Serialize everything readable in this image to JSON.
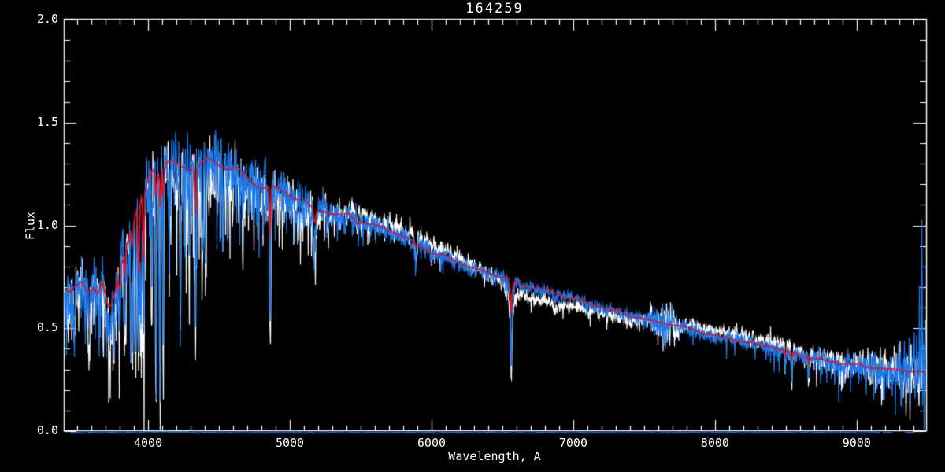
{
  "chart_data": {
    "type": "line",
    "title": "164259",
    "xlabel": "Wavelength, A",
    "ylabel": "Flux",
    "xlim": [
      3405,
      9490
    ],
    "ylim": [
      0.0,
      2.0
    ],
    "grid": false,
    "axes_box": true,
    "x_ticks": {
      "major": [
        4000,
        5000,
        6000,
        7000,
        8000,
        9000
      ],
      "labels": [
        "4000",
        "5000",
        "6000",
        "7000",
        "8000",
        "9000"
      ],
      "minor_step": 100
    },
    "y_ticks": {
      "major": [
        0.0,
        0.5,
        1.0,
        1.5,
        2.0
      ],
      "labels": [
        "0.0",
        "0.5",
        "1.0",
        "1.5",
        "2.0"
      ],
      "minor_step": 0.1
    },
    "colors": {
      "background": "#000000",
      "axis": "#ffffff",
      "observed_blue": "#1b79ea",
      "observed_white": "#ffffff",
      "model_red": "#e31227"
    },
    "series_names": [
      "observed-spectrum-white",
      "observed-spectrum-blue",
      "model-spectrum-red",
      "zero-level-spectrum"
    ],
    "model_points": [
      [
        3405,
        0.67
      ],
      [
        3450,
        0.655
      ],
      [
        3490,
        0.7
      ],
      [
        3530,
        0.735
      ],
      [
        3560,
        0.705
      ],
      [
        3590,
        0.69
      ],
      [
        3615,
        0.71
      ],
      [
        3645,
        0.665
      ],
      [
        3675,
        0.73
      ],
      [
        3700,
        0.66
      ],
      [
        3720,
        0.6
      ],
      [
        3745,
        0.625
      ],
      [
        3770,
        0.7
      ],
      [
        3800,
        0.8
      ],
      [
        3830,
        0.86
      ],
      [
        3860,
        0.93
      ],
      [
        3890,
        0.97
      ],
      [
        3920,
        1.06
      ],
      [
        3955,
        1.12
      ],
      [
        3985,
        1.18
      ],
      [
        4010,
        1.24
      ],
      [
        4040,
        1.28
      ],
      [
        4070,
        1.25
      ],
      [
        4100,
        1.28
      ],
      [
        4140,
        1.305
      ],
      [
        4180,
        1.31
      ],
      [
        4220,
        1.3
      ],
      [
        4260,
        1.3
      ],
      [
        4300,
        1.29
      ],
      [
        4340,
        1.28
      ],
      [
        4380,
        1.3
      ],
      [
        4420,
        1.31
      ],
      [
        4460,
        1.3
      ],
      [
        4500,
        1.29
      ],
      [
        4540,
        1.28
      ],
      [
        4580,
        1.265
      ],
      [
        4620,
        1.27
      ],
      [
        4660,
        1.25
      ],
      [
        4700,
        1.23
      ],
      [
        4740,
        1.22
      ],
      [
        4800,
        1.2
      ],
      [
        4861,
        1.19
      ],
      [
        4920,
        1.175
      ],
      [
        4980,
        1.16
      ],
      [
        5040,
        1.13
      ],
      [
        5100,
        1.1
      ],
      [
        5175,
        1.06
      ],
      [
        5240,
        1.08
      ],
      [
        5300,
        1.065
      ],
      [
        5360,
        1.05
      ],
      [
        5420,
        1.06
      ],
      [
        5480,
        1.025
      ],
      [
        5540,
        1.01
      ],
      [
        5620,
        0.99
      ],
      [
        5700,
        0.975
      ],
      [
        5800,
        0.945
      ],
      [
        5890,
        0.915
      ],
      [
        6000,
        0.875
      ],
      [
        6100,
        0.845
      ],
      [
        6200,
        0.815
      ],
      [
        6300,
        0.785
      ],
      [
        6400,
        0.77
      ],
      [
        6500,
        0.755
      ],
      [
        6563,
        0.745
      ],
      [
        6650,
        0.705
      ],
      [
        6750,
        0.695
      ],
      [
        6844,
        0.67
      ],
      [
        6950,
        0.655
      ],
      [
        7050,
        0.64
      ],
      [
        7122,
        0.615
      ],
      [
        7250,
        0.595
      ],
      [
        7400,
        0.558
      ],
      [
        7530,
        0.54
      ],
      [
        7650,
        0.525
      ],
      [
        7800,
        0.505
      ],
      [
        7956,
        0.468
      ],
      [
        8100,
        0.45
      ],
      [
        8250,
        0.432
      ],
      [
        8400,
        0.41
      ],
      [
        8511,
        0.385
      ],
      [
        8650,
        0.36
      ],
      [
        8789,
        0.342
      ],
      [
        8900,
        0.33
      ],
      [
        9000,
        0.322
      ],
      [
        9067,
        0.31
      ],
      [
        9150,
        0.305
      ],
      [
        9250,
        0.3
      ],
      [
        9350,
        0.295
      ],
      [
        9490,
        0.287
      ]
    ],
    "absorption_lines": [
      [
        3480,
        4,
        0.52,
        null
      ],
      [
        3582,
        4,
        0.46,
        null
      ],
      [
        3655,
        3,
        0.52,
        null
      ],
      [
        3705,
        4,
        0.44,
        null
      ],
      [
        3728,
        3.5,
        0.41,
        null
      ],
      [
        3760,
        3.5,
        0.45,
        null
      ],
      [
        3798,
        3.5,
        0.5,
        0.62
      ],
      [
        3835,
        3.5,
        0.47,
        0.75
      ],
      [
        3878,
        3,
        0.47,
        null
      ],
      [
        3889,
        3,
        0.52,
        0.82
      ],
      [
        3912,
        3.5,
        0.46,
        null
      ],
      [
        3933,
        4.5,
        0.45,
        0.7
      ],
      [
        3950,
        3.5,
        0.47,
        null
      ],
      [
        3968,
        4,
        0.45,
        0.82
      ],
      [
        4026,
        2.5,
        0.6,
        null
      ],
      [
        4056,
        2.5,
        0.24,
        0.92
      ],
      [
        4083,
        2.5,
        0.24,
        0.95
      ],
      [
        4106,
        3,
        0.5,
        1.0
      ],
      [
        4150,
        2.5,
        0.85,
        null
      ],
      [
        4227,
        3,
        0.72,
        null
      ],
      [
        4290,
        2.5,
        0.8,
        null
      ],
      [
        4333,
        3.5,
        0.47,
        0.97
      ],
      [
        4383,
        3,
        0.78,
        null
      ],
      [
        4405,
        2.5,
        0.85,
        null
      ],
      [
        4530,
        2.5,
        0.88,
        null
      ],
      [
        4668,
        2.5,
        0.9,
        null
      ],
      [
        4861,
        3.5,
        0.455,
        0.95
      ],
      [
        5175,
        7,
        0.89,
        1.01
      ],
      [
        5270,
        4,
        0.95,
        null
      ],
      [
        5890,
        5,
        0.79,
        0.89
      ],
      [
        6563,
        13,
        0.63,
        0.685
      ],
      [
        6563,
        3.5,
        0.29,
        0.56
      ],
      [
        6870,
        4,
        0.61,
        null
      ],
      [
        6890,
        3,
        0.65,
        null
      ],
      [
        7180,
        4,
        0.575,
        null
      ],
      [
        7240,
        3,
        0.57,
        null
      ],
      [
        8227,
        3.5,
        0.41,
        null
      ],
      [
        8350,
        3,
        0.4,
        null
      ],
      [
        8498,
        3,
        0.29,
        0.36
      ],
      [
        8542,
        3,
        0.225,
        0.335
      ],
      [
        8662,
        3,
        0.22,
        0.33
      ],
      [
        8750,
        3,
        0.31,
        0.37
      ],
      [
        8844,
        3.5,
        0.275,
        0.345
      ],
      [
        9015,
        4,
        0.29,
        0.335
      ],
      [
        9120,
        3,
        0.3,
        null
      ],
      [
        9217,
        4.5,
        0.255,
        0.3
      ],
      [
        9340,
        3,
        0.32,
        null
      ],
      [
        9408,
        3,
        0.31,
        null
      ]
    ],
    "noise_sigma_profile": [
      [
        3405,
        0.062
      ],
      [
        3600,
        0.062
      ],
      [
        3700,
        0.075
      ],
      [
        3800,
        0.085
      ],
      [
        3900,
        0.085
      ],
      [
        4000,
        0.08
      ],
      [
        4300,
        0.08
      ],
      [
        4600,
        0.078
      ],
      [
        4900,
        0.068
      ],
      [
        5100,
        0.05
      ],
      [
        5300,
        0.034
      ],
      [
        5600,
        0.027
      ],
      [
        6000,
        0.023
      ],
      [
        6300,
        0.018
      ],
      [
        6600,
        0.016
      ],
      [
        7000,
        0.014
      ],
      [
        7400,
        0.014
      ],
      [
        7550,
        0.03
      ],
      [
        7620,
        0.055
      ],
      [
        7690,
        0.045
      ],
      [
        7760,
        0.02
      ],
      [
        8000,
        0.016
      ],
      [
        8300,
        0.018
      ],
      [
        8600,
        0.022
      ],
      [
        8800,
        0.03
      ],
      [
        9000,
        0.035
      ],
      [
        9150,
        0.045
      ],
      [
        9300,
        0.06
      ],
      [
        9400,
        0.09
      ],
      [
        9460,
        0.13
      ],
      [
        9490,
        0.16
      ]
    ],
    "down_spike_profile": [
      [
        3405,
        0.3,
        0.25
      ],
      [
        4000,
        0.35,
        0.42
      ],
      [
        4900,
        0.3,
        0.3
      ],
      [
        5200,
        0.22,
        0.14
      ],
      [
        6300,
        0.12,
        0.07
      ],
      [
        7500,
        0.1,
        0.06
      ],
      [
        8200,
        0.15,
        0.1
      ],
      [
        8700,
        0.18,
        0.12
      ],
      [
        9490,
        0.2,
        0.15
      ]
    ],
    "white_offset_profile": [
      [
        3405,
        -0.015
      ],
      [
        3900,
        -0.03
      ],
      [
        4200,
        -0.05
      ],
      [
        4700,
        -0.055
      ],
      [
        5100,
        -0.04
      ],
      [
        5300,
        0.0
      ],
      [
        5500,
        0.03
      ],
      [
        5900,
        0.035
      ],
      [
        6200,
        0.03
      ],
      [
        6450,
        -0.02
      ],
      [
        6600,
        -0.055
      ],
      [
        6900,
        -0.045
      ],
      [
        7300,
        -0.02
      ],
      [
        7700,
        0.0
      ],
      [
        8000,
        0.03
      ],
      [
        8400,
        0.028
      ],
      [
        8700,
        0.015
      ],
      [
        9000,
        0.005
      ],
      [
        9490,
        0.0
      ]
    ],
    "up_spikes": [
      [
        9333,
        0.55
      ],
      [
        9370,
        0.5
      ],
      [
        9400,
        0.62
      ],
      [
        9425,
        0.58
      ],
      [
        9443,
        0.75
      ],
      [
        9460,
        1.13
      ],
      [
        9472,
        0.66
      ],
      [
        9482,
        0.58
      ]
    ],
    "zero_line": {
      "flux": 0.0,
      "start": 3450,
      "end": 9490
    },
    "seeds": {
      "white": 11,
      "blue": 7
    }
  }
}
